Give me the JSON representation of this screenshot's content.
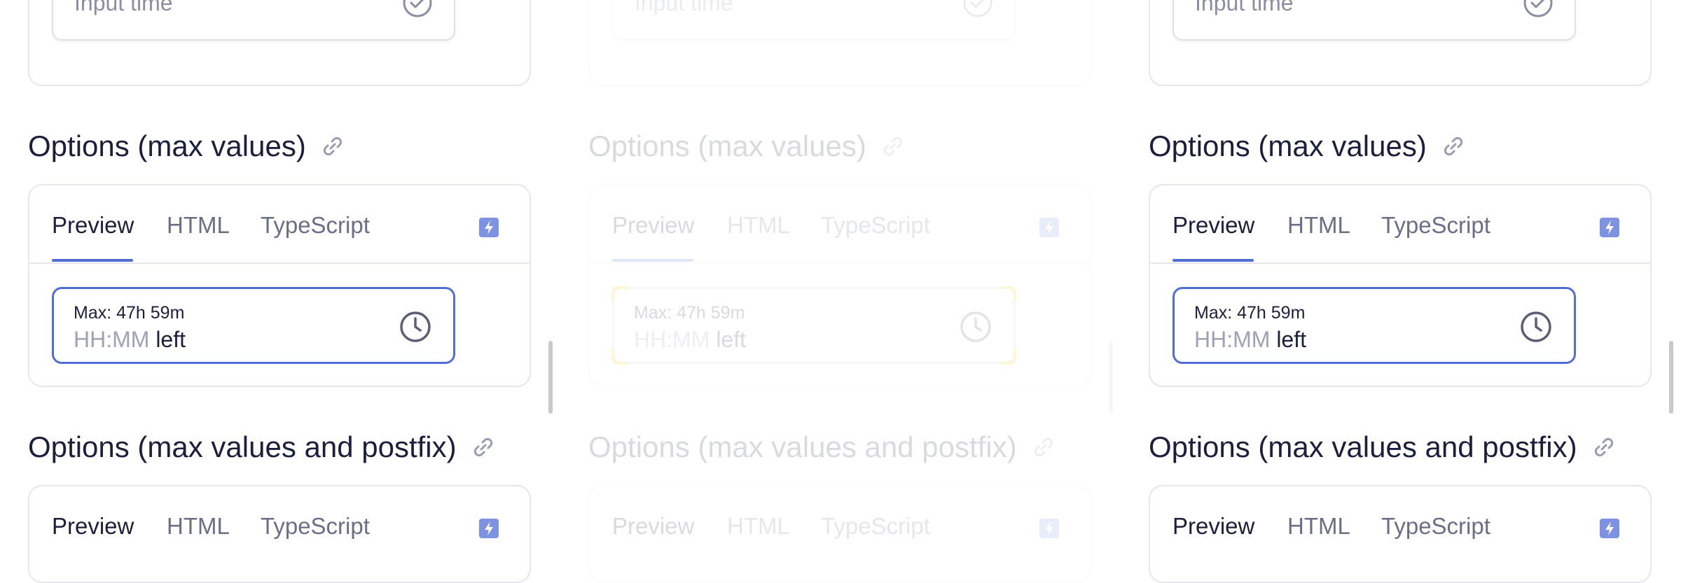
{
  "panels": [
    {
      "id": "left",
      "faded": false
    },
    {
      "id": "middle",
      "faded": true
    },
    {
      "id": "right",
      "faded": false
    }
  ],
  "top_card": {
    "placeholder": "Input time"
  },
  "section_max": {
    "title": "Options (max values)"
  },
  "section_postfix": {
    "title": "Options (max values and postfix)"
  },
  "tabs": {
    "preview": "Preview",
    "html": "HTML",
    "typescript": "TypeScript"
  },
  "time_field": {
    "label": "Max: 47h 59m",
    "mask": "HH:MM",
    "postfix": "left"
  },
  "colors": {
    "accent": "#526ed3",
    "bolt": "#7d92e0",
    "border": "#e6e7ee"
  },
  "icons": {
    "check": "check-circle-icon",
    "link": "link-icon",
    "bolt": "lightning-icon",
    "clock": "clock-icon"
  }
}
